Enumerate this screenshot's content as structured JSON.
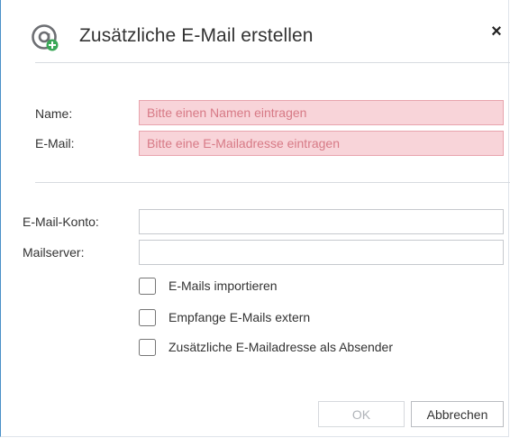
{
  "dialog": {
    "title": "Zusätzliche E-Mail erstellen",
    "close_symbol": "×",
    "icon": "at-sign-plus-icon"
  },
  "form": {
    "name_label": "Name:",
    "name_placeholder": "Bitte einen Namen eintragen",
    "name_value": "",
    "email_label": "E-Mail:",
    "email_placeholder": "Bitte eine E-Mailadresse eintragen",
    "email_value": "",
    "account_label": "E-Mail-Konto:",
    "account_value": "",
    "server_label": "Mailserver:",
    "server_value": ""
  },
  "options": [
    {
      "label": "E-Mails importieren",
      "checked": false
    },
    {
      "label": "Empfange E-Mails extern",
      "checked": false
    },
    {
      "label": "Zusätzliche E-Mailadresse als Absender",
      "checked": false
    }
  ],
  "buttons": {
    "ok_label": "OK",
    "ok_enabled": false,
    "cancel_label": "Abbrechen"
  },
  "colors": {
    "required_field_bg": "#f8d4d9",
    "accent_green": "#3aa757",
    "icon_gray": "#6d6f73"
  }
}
